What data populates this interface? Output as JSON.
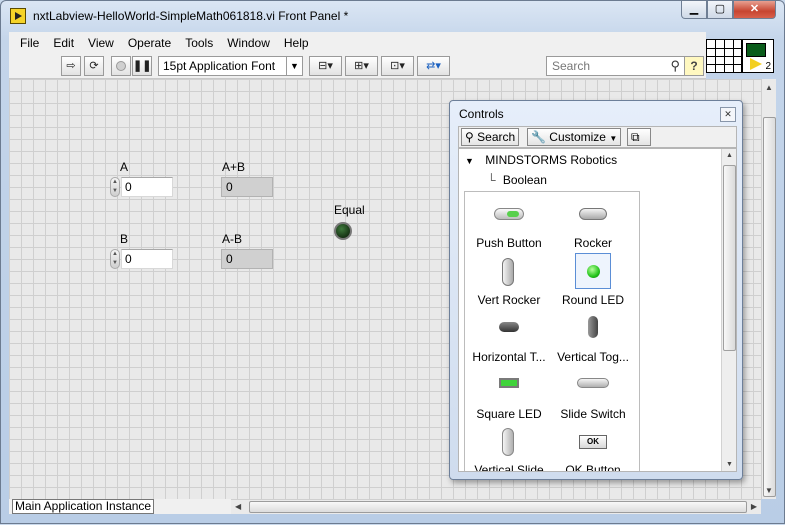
{
  "window": {
    "title": "nxtLabview-HelloWorld-SimpleMath061818.vi Front Panel *"
  },
  "menu": [
    "File",
    "Edit",
    "View",
    "Operate",
    "Tools",
    "Window",
    "Help"
  ],
  "toolbar": {
    "font": "15pt Application Font",
    "search_placeholder": "Search"
  },
  "connector": {
    "vi_number": "2"
  },
  "front_panel": {
    "a": {
      "label": "A",
      "value": "0"
    },
    "b": {
      "label": "B",
      "value": "0"
    },
    "a_plus_b": {
      "label": "A+B",
      "value": "0"
    },
    "a_minus_b": {
      "label": "A-B",
      "value": "0"
    },
    "equal": {
      "label": "Equal",
      "state": "off"
    }
  },
  "palette": {
    "title": "Controls",
    "search_label": "Search",
    "customize_label": "Customize",
    "category": "MINDSTORMS Robotics",
    "subcategory": "Boolean",
    "items": [
      {
        "label": "Push Button",
        "icon": "push-button-icon"
      },
      {
        "label": "Rocker",
        "icon": "rocker-icon"
      },
      {
        "label": "Vert Rocker",
        "icon": "vert-rocker-icon"
      },
      {
        "label": "Round LED",
        "icon": "round-led-icon"
      },
      {
        "label": "Horizontal T...",
        "icon": "horizontal-toggle-icon"
      },
      {
        "label": "Vertical Tog...",
        "icon": "vertical-toggle-icon"
      },
      {
        "label": "Square LED",
        "icon": "square-led-icon"
      },
      {
        "label": "Slide Switch",
        "icon": "slide-switch-icon"
      },
      {
        "label": "Vertical Slide",
        "icon": "vertical-slide-icon"
      },
      {
        "label": "OK Button",
        "icon": "ok-button-icon"
      }
    ],
    "ok_icon_text": "OK"
  },
  "status": {
    "text": "Main Application Instance"
  },
  "colors": {
    "panel_bg": "#e9e9e9",
    "led_on": "#23c41a",
    "led_off": "#1c3d1a"
  }
}
